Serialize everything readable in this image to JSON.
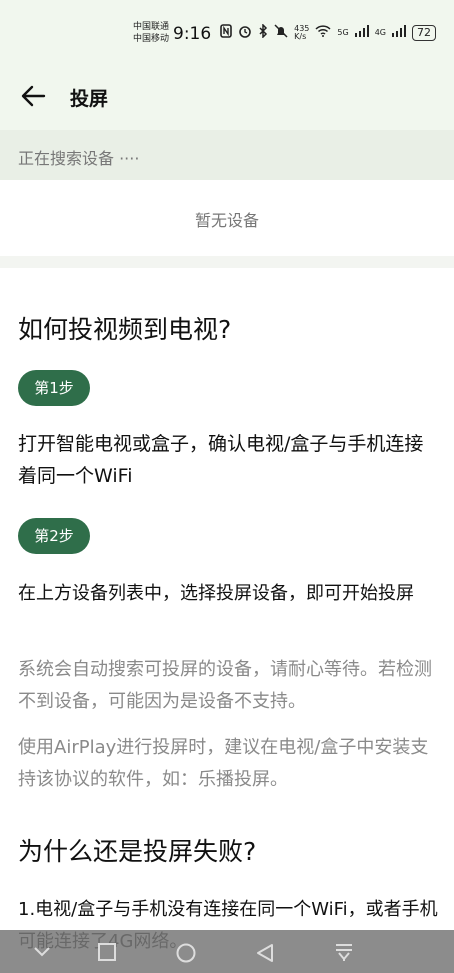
{
  "status": {
    "carrier1": "中国联通",
    "carrier2": "中国移动",
    "time": "9:16",
    "speed_top": "435",
    "speed_unit": "K/s",
    "net5g": "5G",
    "net4g": "4G",
    "battery": "72",
    "icons": [
      "nfc-icon",
      "alarm-icon",
      "bluetooth-icon",
      "mute-icon",
      "wifi-icon",
      "signal-icon"
    ]
  },
  "header": {
    "title": "投屏"
  },
  "search": {
    "status_text": "正在搜索设备 ····"
  },
  "devices": {
    "empty_text": "暂无设备"
  },
  "help": {
    "title": "如何投视频到电视?",
    "steps": [
      {
        "label": "第1步",
        "text": "打开智能电视或盒子，确认电视/盒子与手机连接着同一个WiFi"
      },
      {
        "label": "第2步",
        "text": "在上方设备列表中，选择投屏设备，即可开始投屏"
      }
    ],
    "notes": [
      "系统会自动搜索可投屏的设备，请耐心等待。若检测不到设备，可能因为是设备不支持。",
      "使用AirPlay进行投屏时，建议在电视/盒子中安装支持该协议的软件，如：乐播投屏。"
    ]
  },
  "fail": {
    "title": "为什么还是投屏失败?",
    "reason1": "1.电视/盒子与手机没有连接在同一个WiFi，或者手机可能连接了4G网络。"
  },
  "colors": {
    "accent": "#2f6e4a",
    "header_bg": "#f1f7ee"
  }
}
